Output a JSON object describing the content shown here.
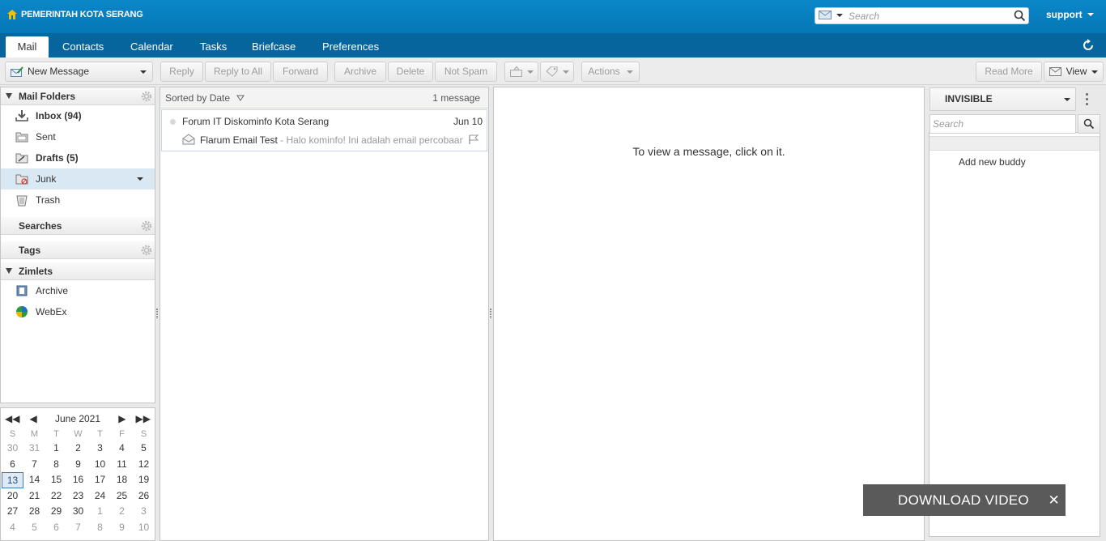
{
  "header": {
    "org_name": "PEMERINTAH KOTA SERANG",
    "search_placeholder": "Search",
    "user": "support"
  },
  "tabs": [
    {
      "label": "Mail"
    },
    {
      "label": "Contacts"
    },
    {
      "label": "Calendar"
    },
    {
      "label": "Tasks"
    },
    {
      "label": "Briefcase"
    },
    {
      "label": "Preferences"
    }
  ],
  "toolbar": {
    "new_message": "New Message",
    "reply": "Reply",
    "reply_all": "Reply to All",
    "forward": "Forward",
    "archive": "Archive",
    "delete": "Delete",
    "not_spam": "Not Spam",
    "actions": "Actions",
    "read_more": "Read More",
    "view": "View"
  },
  "folders": {
    "title": "Mail Folders",
    "items": [
      {
        "label": "Inbox (94)"
      },
      {
        "label": "Sent"
      },
      {
        "label": "Drafts (5)"
      },
      {
        "label": "Junk"
      },
      {
        "label": "Trash"
      }
    ]
  },
  "searches": {
    "title": "Searches"
  },
  "tags": {
    "title": "Tags"
  },
  "zimlets": {
    "title": "Zimlets",
    "items": [
      {
        "label": "Archive"
      },
      {
        "label": "WebEx"
      }
    ]
  },
  "calendar": {
    "month": "June 2021",
    "dow": [
      "S",
      "M",
      "T",
      "W",
      "T",
      "F",
      "S"
    ],
    "weeks": [
      [
        "30",
        "31",
        "1",
        "2",
        "3",
        "4",
        "5"
      ],
      [
        "6",
        "7",
        "8",
        "9",
        "10",
        "11",
        "12"
      ],
      [
        "13",
        "14",
        "15",
        "16",
        "17",
        "18",
        "19"
      ],
      [
        "20",
        "21",
        "22",
        "23",
        "24",
        "25",
        "26"
      ],
      [
        "27",
        "28",
        "29",
        "30",
        "1",
        "2",
        "3"
      ],
      [
        "4",
        "5",
        "6",
        "7",
        "8",
        "9",
        "10"
      ]
    ],
    "today": "13"
  },
  "list": {
    "sort_label": "Sorted by Date",
    "count": "1 message",
    "messages": [
      {
        "from": "Forum IT Diskominfo Kota Serang",
        "date": "Jun 10",
        "subject": "Flarum Email Test",
        "fragment": " - Halo kominfo! Ini adalah email percobaan"
      }
    ]
  },
  "reading": {
    "hint": "To view a message, click on it."
  },
  "buddy": {
    "status": "INVISIBLE",
    "search_placeholder": "Search",
    "add_buddy": "Add new buddy"
  },
  "toast": {
    "label": "DOWNLOAD VIDEO"
  }
}
